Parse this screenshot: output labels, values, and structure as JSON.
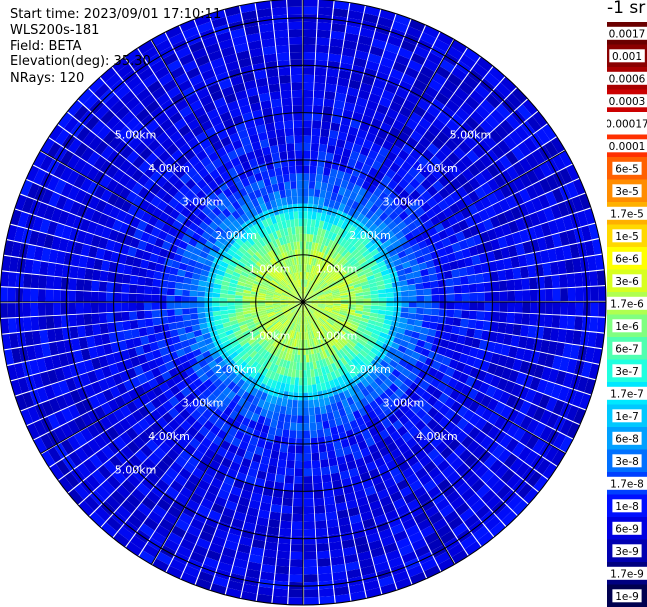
{
  "header": {
    "start_time": "Start time: 2023/09/01 17:10:11",
    "instrument": "WLS200s-181",
    "field": "Field: BETA",
    "elevation": "Elevation(deg): 35.30",
    "nrays": "NRays: 120",
    "units": "-1 sr"
  },
  "chart_data": {
    "type": "heatmap",
    "projection": "polar-ppi",
    "field": "BETA",
    "elevation_deg": 35.3,
    "n_rays": 120,
    "max_range_km": 6.4,
    "range_rings_km": [
      1,
      2,
      3,
      4,
      5,
      6
    ],
    "spokes_deg": [
      0,
      30,
      60,
      90,
      120,
      150,
      180,
      210,
      240,
      270,
      300,
      330
    ],
    "ring_labels": [
      {
        "text": "1.00km",
        "range_km": 1,
        "angle_deg": 315
      },
      {
        "text": "1.00km",
        "range_km": 1,
        "angle_deg": 45
      },
      {
        "text": "1.00km",
        "range_km": 1,
        "angle_deg": 225
      },
      {
        "text": "1.00km",
        "range_km": 1,
        "angle_deg": 135
      },
      {
        "text": "2.00km",
        "range_km": 2,
        "angle_deg": 315
      },
      {
        "text": "2.00km",
        "range_km": 2,
        "angle_deg": 45
      },
      {
        "text": "2.00km",
        "range_km": 2,
        "angle_deg": 225
      },
      {
        "text": "2.00km",
        "range_km": 2,
        "angle_deg": 135
      },
      {
        "text": "3.00km",
        "range_km": 3,
        "angle_deg": 315
      },
      {
        "text": "3.00km",
        "range_km": 3,
        "angle_deg": 45
      },
      {
        "text": "3.00km",
        "range_km": 3,
        "angle_deg": 225
      },
      {
        "text": "3.00km",
        "range_km": 3,
        "angle_deg": 135
      },
      {
        "text": "4.00km",
        "range_km": 4,
        "angle_deg": 315
      },
      {
        "text": "4.00km",
        "range_km": 4,
        "angle_deg": 45
      },
      {
        "text": "4.00km",
        "range_km": 4,
        "angle_deg": 225
      },
      {
        "text": "4.00km",
        "range_km": 4,
        "angle_deg": 135
      },
      {
        "text": "5.00km",
        "range_km": 5,
        "angle_deg": 315
      },
      {
        "text": "5.00km",
        "range_km": 5,
        "angle_deg": 45
      },
      {
        "text": "5.00km",
        "range_km": 5,
        "angle_deg": 225
      }
    ],
    "profile": [
      {
        "range_km": 0.0,
        "value": "1.7e-6"
      },
      {
        "range_km": 1.0,
        "value": "1.7e-6"
      },
      {
        "range_km": 1.8,
        "value": "3e-7"
      },
      {
        "range_km": 2.2,
        "value": "3e-8"
      },
      {
        "range_km": 3.0,
        "value": "1e-8"
      },
      {
        "range_km": 4.5,
        "value": "6e-9"
      },
      {
        "range_km": 6.4,
        "value": "6e-9"
      }
    ],
    "colorbar": {
      "labels": [
        "0.0017",
        "0.001",
        "0.0006",
        "0.0003",
        "0.00017",
        "0.0001",
        "6e-5",
        "3e-5",
        "1.7e-5",
        "1e-5",
        "6e-6",
        "3e-6",
        "1.7e-6",
        "1e-6",
        "6e-7",
        "3e-7",
        "1.7e-7",
        "1e-7",
        "6e-8",
        "3e-8",
        "1.7e-8",
        "1e-8",
        "6e-9",
        "3e-9",
        "1.7e-9",
        "1e-9"
      ],
      "colors": [
        "#6a0000",
        "#8a0000",
        "#aa0000",
        "#cc0000",
        "#ffffff",
        "#ff3000",
        "#ff6000",
        "#ff8c00",
        "#ffb000",
        "#ffd800",
        "#ffff00",
        "#d8ff20",
        "#b0ff50",
        "#80ff80",
        "#50ffb0",
        "#20ffe0",
        "#00e8ff",
        "#00c8ff",
        "#00a0ff",
        "#0070ff",
        "#0040ff",
        "#0010ff",
        "#0000e0",
        "#0000b0",
        "#000080",
        "#000050"
      ]
    }
  }
}
